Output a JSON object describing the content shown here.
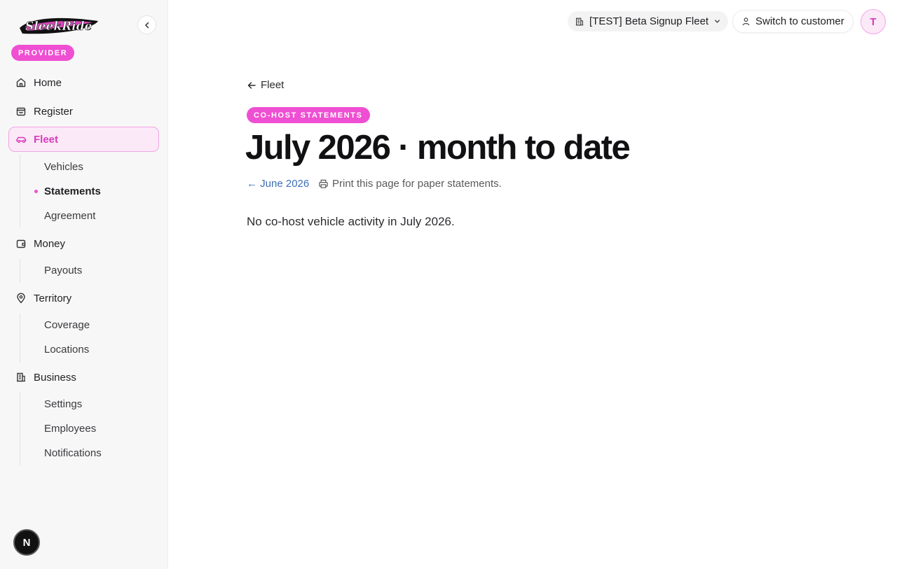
{
  "brand": {
    "name": "SleekRide",
    "role_badge": "PROVIDER"
  },
  "sidebar": {
    "items": [
      {
        "label": "Home",
        "icon": "home-icon"
      },
      {
        "label": "Register",
        "icon": "register-icon"
      },
      {
        "label": "Fleet",
        "icon": "car-icon",
        "active": true
      },
      {
        "label": "Money",
        "icon": "wallet-icon"
      },
      {
        "label": "Territory",
        "icon": "map-pin-icon"
      },
      {
        "label": "Business",
        "icon": "building-icon"
      }
    ],
    "fleet_sub": [
      "Vehicles",
      "Statements",
      "Agreement"
    ],
    "money_sub": [
      "Payouts"
    ],
    "territory_sub": [
      "Coverage",
      "Locations"
    ],
    "business_sub": [
      "Settings",
      "Employees",
      "Notifications"
    ],
    "bottom_avatar": "N"
  },
  "topbar": {
    "fleet_selector": "[TEST] Beta Signup Fleet",
    "switch_button": "Switch to customer",
    "user_initial": "T"
  },
  "main": {
    "back_link": "Fleet",
    "section_badge": "CO-HOST STATEMENTS",
    "title": "July 2026 · month to date",
    "prev_month": "← June 2026",
    "print_note": "Print this page for paper statements.",
    "empty_message": "No co-host vehicle activity in July 2026."
  },
  "colors": {
    "accent": "#ef4fd2",
    "link": "#3b6fb6"
  }
}
